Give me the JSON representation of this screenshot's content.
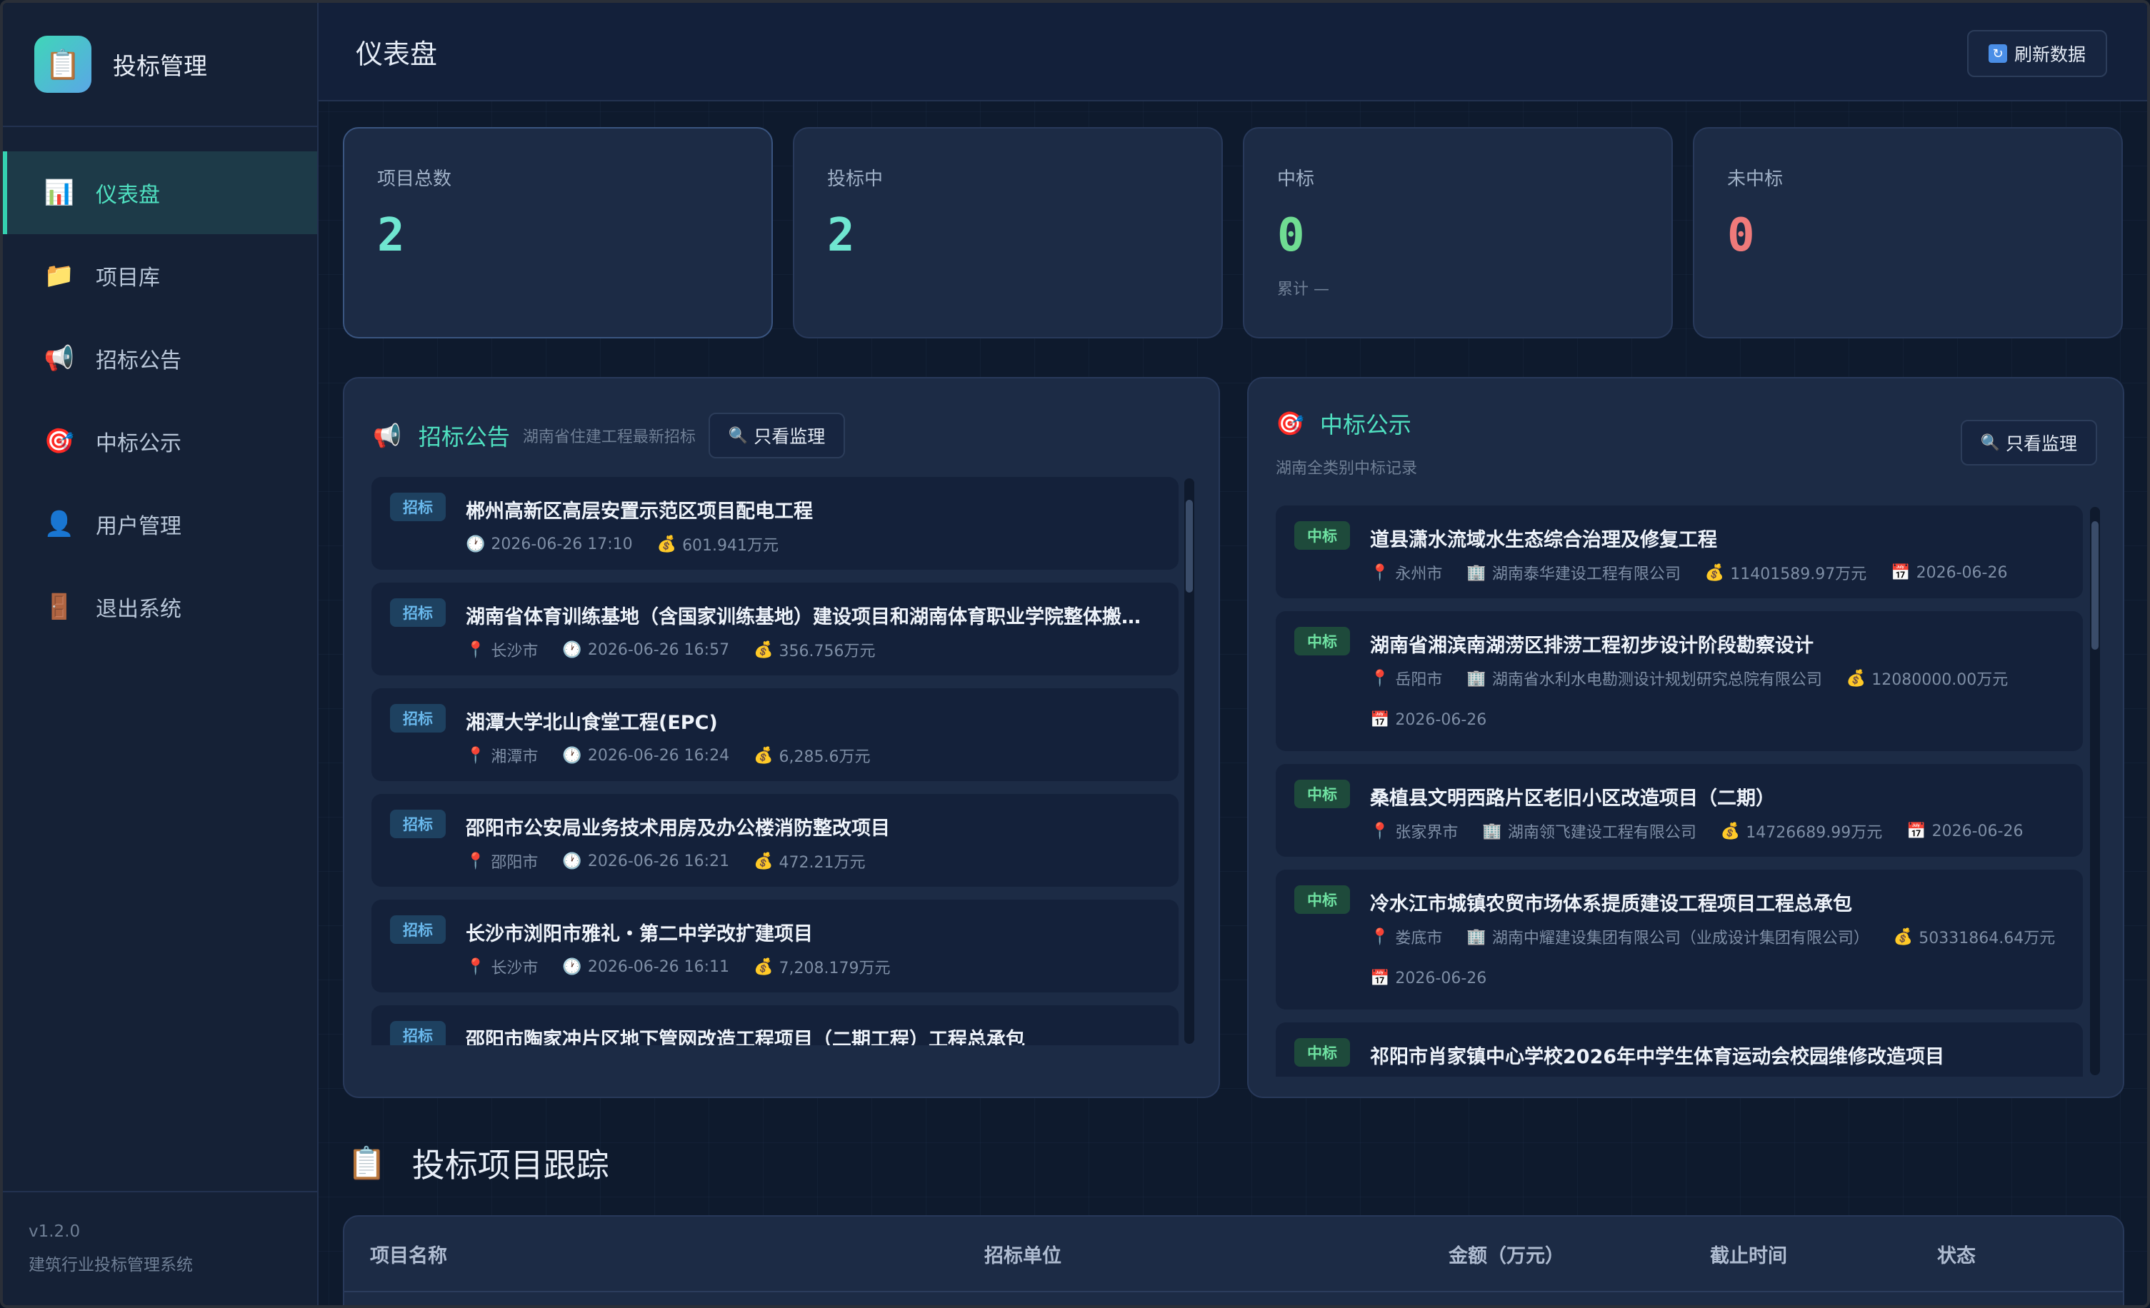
{
  "app": {
    "title": "投标管理",
    "logo_icon": "📋"
  },
  "sidebar": {
    "items": [
      {
        "label": "仪表盘",
        "icon": "📊",
        "active": true
      },
      {
        "label": "项目库",
        "icon": "📁",
        "active": false
      },
      {
        "label": "招标公告",
        "icon": "📢",
        "active": false
      },
      {
        "label": "中标公示",
        "icon": "🎯",
        "active": false
      },
      {
        "label": "用户管理",
        "icon": "👤",
        "active": false
      },
      {
        "label": "退出系统",
        "icon": "🚪",
        "active": false
      }
    ],
    "version": "v1.2.0",
    "system_name": "建筑行业投标管理系统"
  },
  "header": {
    "title": "仪表盘",
    "refresh_label": "刷新数据",
    "refresh_icon": "🔄"
  },
  "stats": [
    {
      "label": "项目总数",
      "value": "2",
      "color": "#6fe6d0",
      "sub": ""
    },
    {
      "label": "投标中",
      "value": "2",
      "color": "#6fe6d0",
      "sub": ""
    },
    {
      "label": "中标",
      "value": "0",
      "color": "#6fdc92",
      "sub": "累计 —"
    },
    {
      "label": "未中标",
      "value": "0",
      "color": "#ef7a7a",
      "sub": ""
    }
  ],
  "tender_panel": {
    "icon": "📢",
    "title": "招标公告",
    "subtitle": "湖南省住建工程最新招标",
    "filter_label": "只看监理",
    "items": [
      {
        "tag": "招标",
        "title": "郴州高新区高层安置示范区项目配电工程",
        "city": "",
        "time": "2026-06-26 17:10",
        "amount": "601.941万元"
      },
      {
        "tag": "招标",
        "title": "湖南省体育训练基地（含国家训练基地）建设项目和湖南体育职业学院整体搬迁…",
        "city": "长沙市",
        "time": "2026-06-26 16:57",
        "amount": "356.756万元"
      },
      {
        "tag": "招标",
        "title": "湘潭大学北山食堂工程(EPC)",
        "city": "湘潭市",
        "time": "2026-06-26 16:24",
        "amount": "6,285.6万元"
      },
      {
        "tag": "招标",
        "title": "邵阳市公安局业务技术用房及办公楼消防整改项目",
        "city": "邵阳市",
        "time": "2026-06-26 16:21",
        "amount": "472.21万元"
      },
      {
        "tag": "招标",
        "title": "长沙市浏阳市雅礼・第二中学改扩建项目",
        "city": "长沙市",
        "time": "2026-06-26 16:11",
        "amount": "7,208.179万元"
      },
      {
        "tag": "招标",
        "title": "邵阳市陶家冲片区地下管网改造工程项目（二期工程）工程总承包",
        "city": "",
        "time": "",
        "amount": ""
      }
    ]
  },
  "award_panel": {
    "icon": "🎯",
    "title": "中标公示",
    "subtitle": "湖南全类别中标记录",
    "filter_label": "只看监理",
    "items": [
      {
        "tag": "中标",
        "title": "道县潇水流域水生态综合治理及修复工程",
        "city": "永州市",
        "company": "湖南泰华建设工程有限公司",
        "amount": "11401589.97万元",
        "date": "2026-06-26",
        "wrap": false
      },
      {
        "tag": "中标",
        "title": "湖南省湘滨南湖涝区排涝工程初步设计阶段勘察设计",
        "city": "岳阳市",
        "company": "湖南省水利水电勘测设计规划研究总院有限公司",
        "amount": "12080000.00万元",
        "date": "2026-06-26",
        "wrap": true
      },
      {
        "tag": "中标",
        "title": "桑植县文明西路片区老旧小区改造项目（二期）",
        "city": "张家界市",
        "company": "湖南领飞建设工程有限公司",
        "amount": "14726689.99万元",
        "date": "2026-06-26",
        "wrap": false
      },
      {
        "tag": "中标",
        "title": "冷水江市城镇农贸市场体系提质建设工程项目工程总承包",
        "city": "娄底市",
        "company": "湖南中耀建设集团有限公司（业成设计集团有限公司）",
        "amount": "50331864.64万元",
        "date": "2026-06-26",
        "wrap": true
      },
      {
        "tag": "中标",
        "title": "祁阳市肖家镇中心学校2026年中学生体育运动会校园维修改造项目",
        "city": "",
        "company": "",
        "amount": "",
        "date": "",
        "wrap": false
      }
    ]
  },
  "tracking": {
    "icon": "📋",
    "title": "投标项目跟踪",
    "columns": [
      "项目名称",
      "招标单位",
      "金额（万元）",
      "截止时间",
      "状态"
    ]
  }
}
